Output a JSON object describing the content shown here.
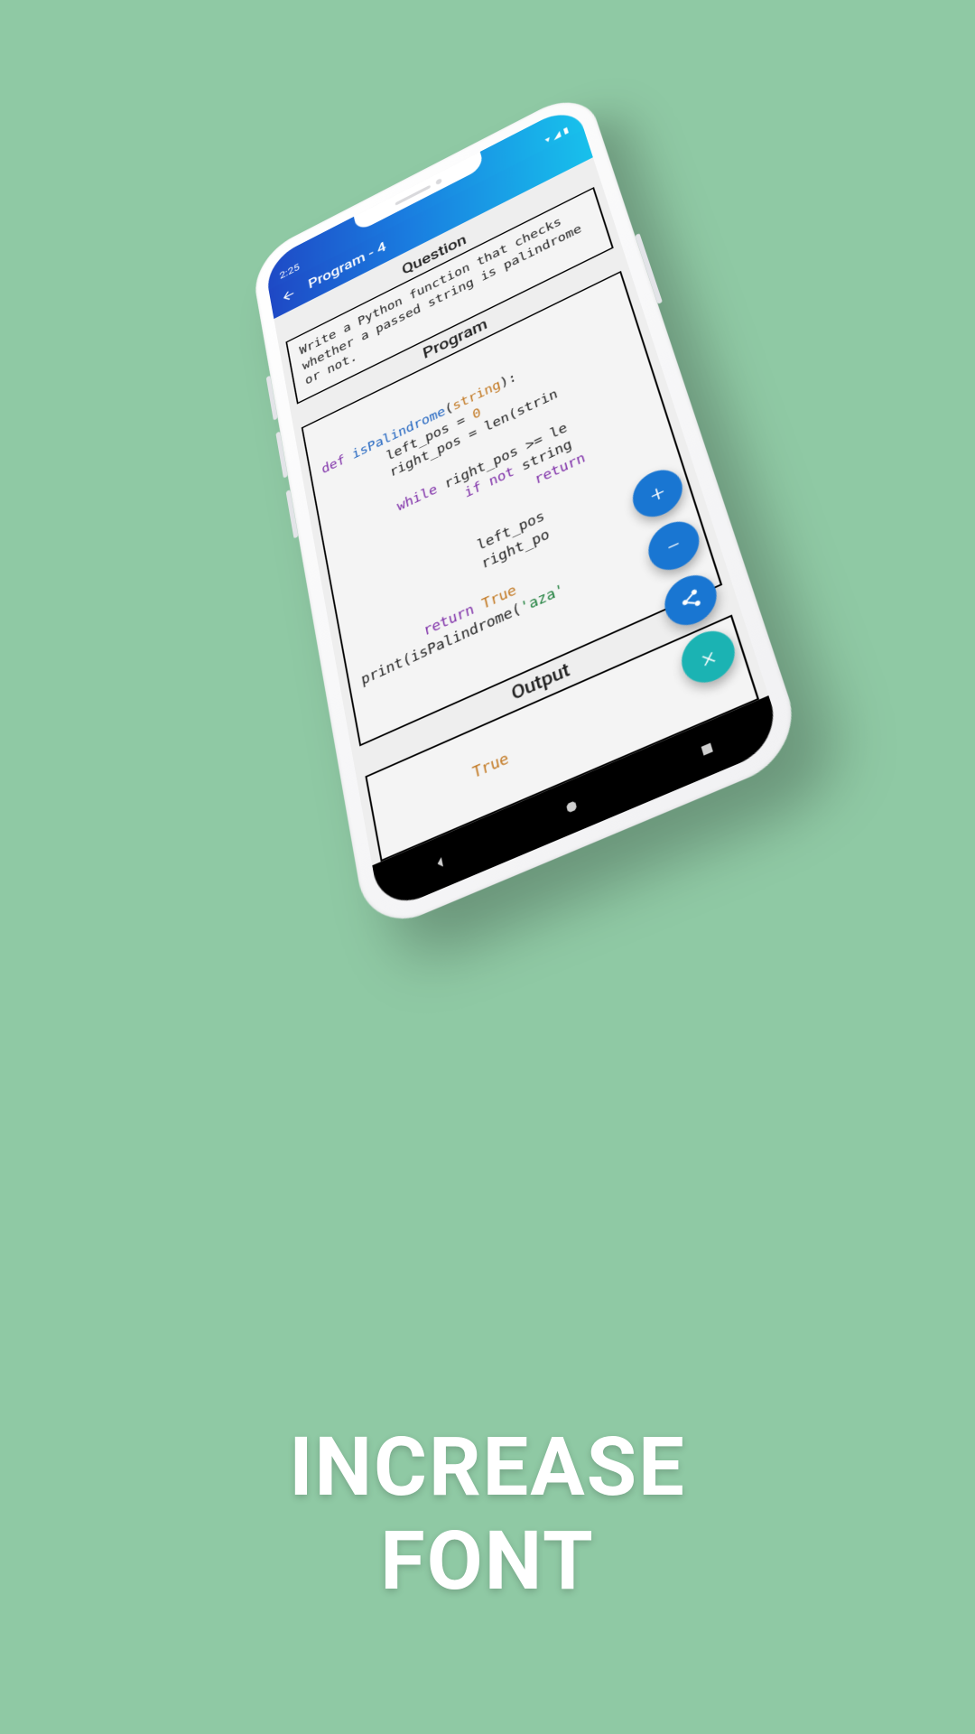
{
  "marketing": {
    "caption_line1": "INCREASE",
    "caption_line2": "FONT"
  },
  "status": {
    "time": "2:25",
    "wifi": "▾",
    "signal": "◢",
    "battery": "▮"
  },
  "appbar": {
    "title": "Program - 4",
    "back_icon": "arrow-left"
  },
  "sections": {
    "question_title": "Question",
    "program_title": "Program",
    "output_title": "Output"
  },
  "question_text": "Write a Python function that checks whether a passed string is palindrome or not.",
  "program_lines": [
    {
      "kw": "def ",
      "fn": "isPalindrome",
      "plain1": "(",
      "param": "string",
      "plain2": "):"
    },
    {
      "indent": "        ",
      "plain": "left_pos = ",
      "num": "0"
    },
    {
      "indent": "        ",
      "plain": "right_pos = len(strin"
    },
    {
      "blank": true
    },
    {
      "indent": "        ",
      "kw": "while ",
      "plain": "right_pos >= le"
    },
    {
      "indent": "                ",
      "kw": "if not ",
      "plain": "string"
    },
    {
      "indent": "                        ",
      "kw": "return"
    },
    {
      "blank": true
    },
    {
      "indent": "                ",
      "plain": "left_pos"
    },
    {
      "indent": "                ",
      "plain": "right_po"
    },
    {
      "blank": true
    },
    {
      "indent": "        ",
      "kw": "return ",
      "param": "True"
    },
    {
      "plain1": "print(isPalindrome(",
      "str": "'aza'",
      "plain2": ""
    }
  ],
  "output_text": "True",
  "fabs": {
    "plus": "+",
    "minus": "−",
    "share": "share",
    "close": "×"
  }
}
